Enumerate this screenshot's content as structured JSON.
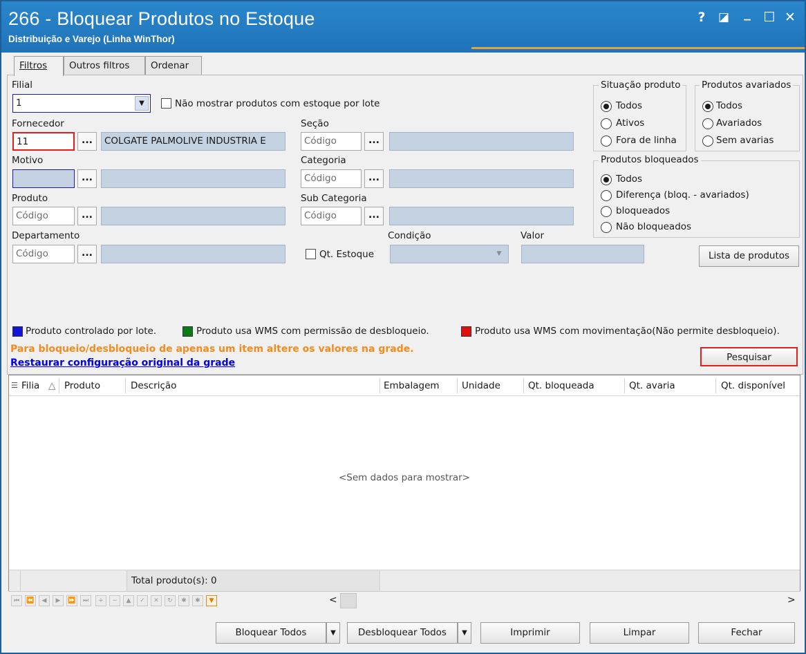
{
  "window": {
    "title": "266 - Bloquear Produtos no Estoque",
    "subtitle": "Distribuição e Varejo (Linha WinThor)",
    "controls": {
      "help": "?",
      "restore": "◪",
      "minimize": "_",
      "maximize": "☐",
      "close": "✕"
    }
  },
  "tabs": [
    {
      "label": "Filtros"
    },
    {
      "label": "Outros filtros"
    },
    {
      "label": "Ordenar"
    }
  ],
  "filters": {
    "filial_label": "Filial",
    "filial_value": "1",
    "nao_mostrar_lote_label": "Não mostrar produtos com estoque por lote",
    "fornecedor_label": "Fornecedor",
    "fornecedor_code": "11",
    "fornecedor_name": "COLGATE PALMOLIVE INDUSTRIA  E",
    "motivo_label": "Motivo",
    "produto_label": "Produto",
    "departamento_label": "Departamento",
    "secao_label": "Seção",
    "categoria_label": "Categoria",
    "subcategoria_label": "Sub Categoria",
    "codigo_placeholder": "Código",
    "ellipsis": "...",
    "condicao_label": "Condição",
    "valor_label": "Valor",
    "qt_estoque_label": "Qt. Estoque"
  },
  "situacao_produto": {
    "title": "Situação produto",
    "options": [
      "Todos",
      "Ativos",
      "Fora de linha"
    ],
    "selected": "Todos"
  },
  "produtos_avariados": {
    "title": "Produtos avariados",
    "options": [
      "Todos",
      "Avariados",
      "Sem avarias"
    ],
    "selected": "Todos"
  },
  "produtos_bloqueados": {
    "title": "Produtos bloqueados",
    "options": [
      "Todos",
      "Diferença (bloq. - avariados)",
      "bloqueados",
      "Não bloqueados"
    ],
    "selected": "Todos"
  },
  "buttons": {
    "lista_produtos": "Lista de produtos",
    "pesquisar": "Pesquisar",
    "bloquear_todos": "Bloquear Todos",
    "desbloquear_todos": "Desbloquear Todos",
    "imprimir": "Imprimir",
    "limpar": "Limpar",
    "fechar": "Fechar"
  },
  "legend": {
    "items": [
      {
        "label": "Produto controlado por lote.",
        "color": "#1414d8"
      },
      {
        "label": "Produto usa WMS com permissão de desbloqueio.",
        "color": "#0b7a1a"
      },
      {
        "label": "Produto usa WMS com movimentação(Não permite desbloqueio).",
        "color": "#e01010"
      }
    ],
    "hint": "Para bloqueio/desbloqueio de apenas um item altere os valores na grade.",
    "restore_link": "Restaurar configuração original da grade"
  },
  "grid": {
    "columns": [
      "Filia",
      "Produto",
      "Descrição",
      "Embalagem",
      "Unidade",
      "Qt. bloqueada",
      "Qt. avaria",
      "Qt. disponível"
    ],
    "empty_text": "<Sem dados para mostrar>",
    "footer_total": "Total produto(s): 0",
    "sort_indicator": "△"
  },
  "colors": {
    "titlebar": "#1f73b8",
    "accent_orange": "#f28c1e",
    "link_blue": "#0000ee",
    "highlight_red": "#e02020"
  }
}
